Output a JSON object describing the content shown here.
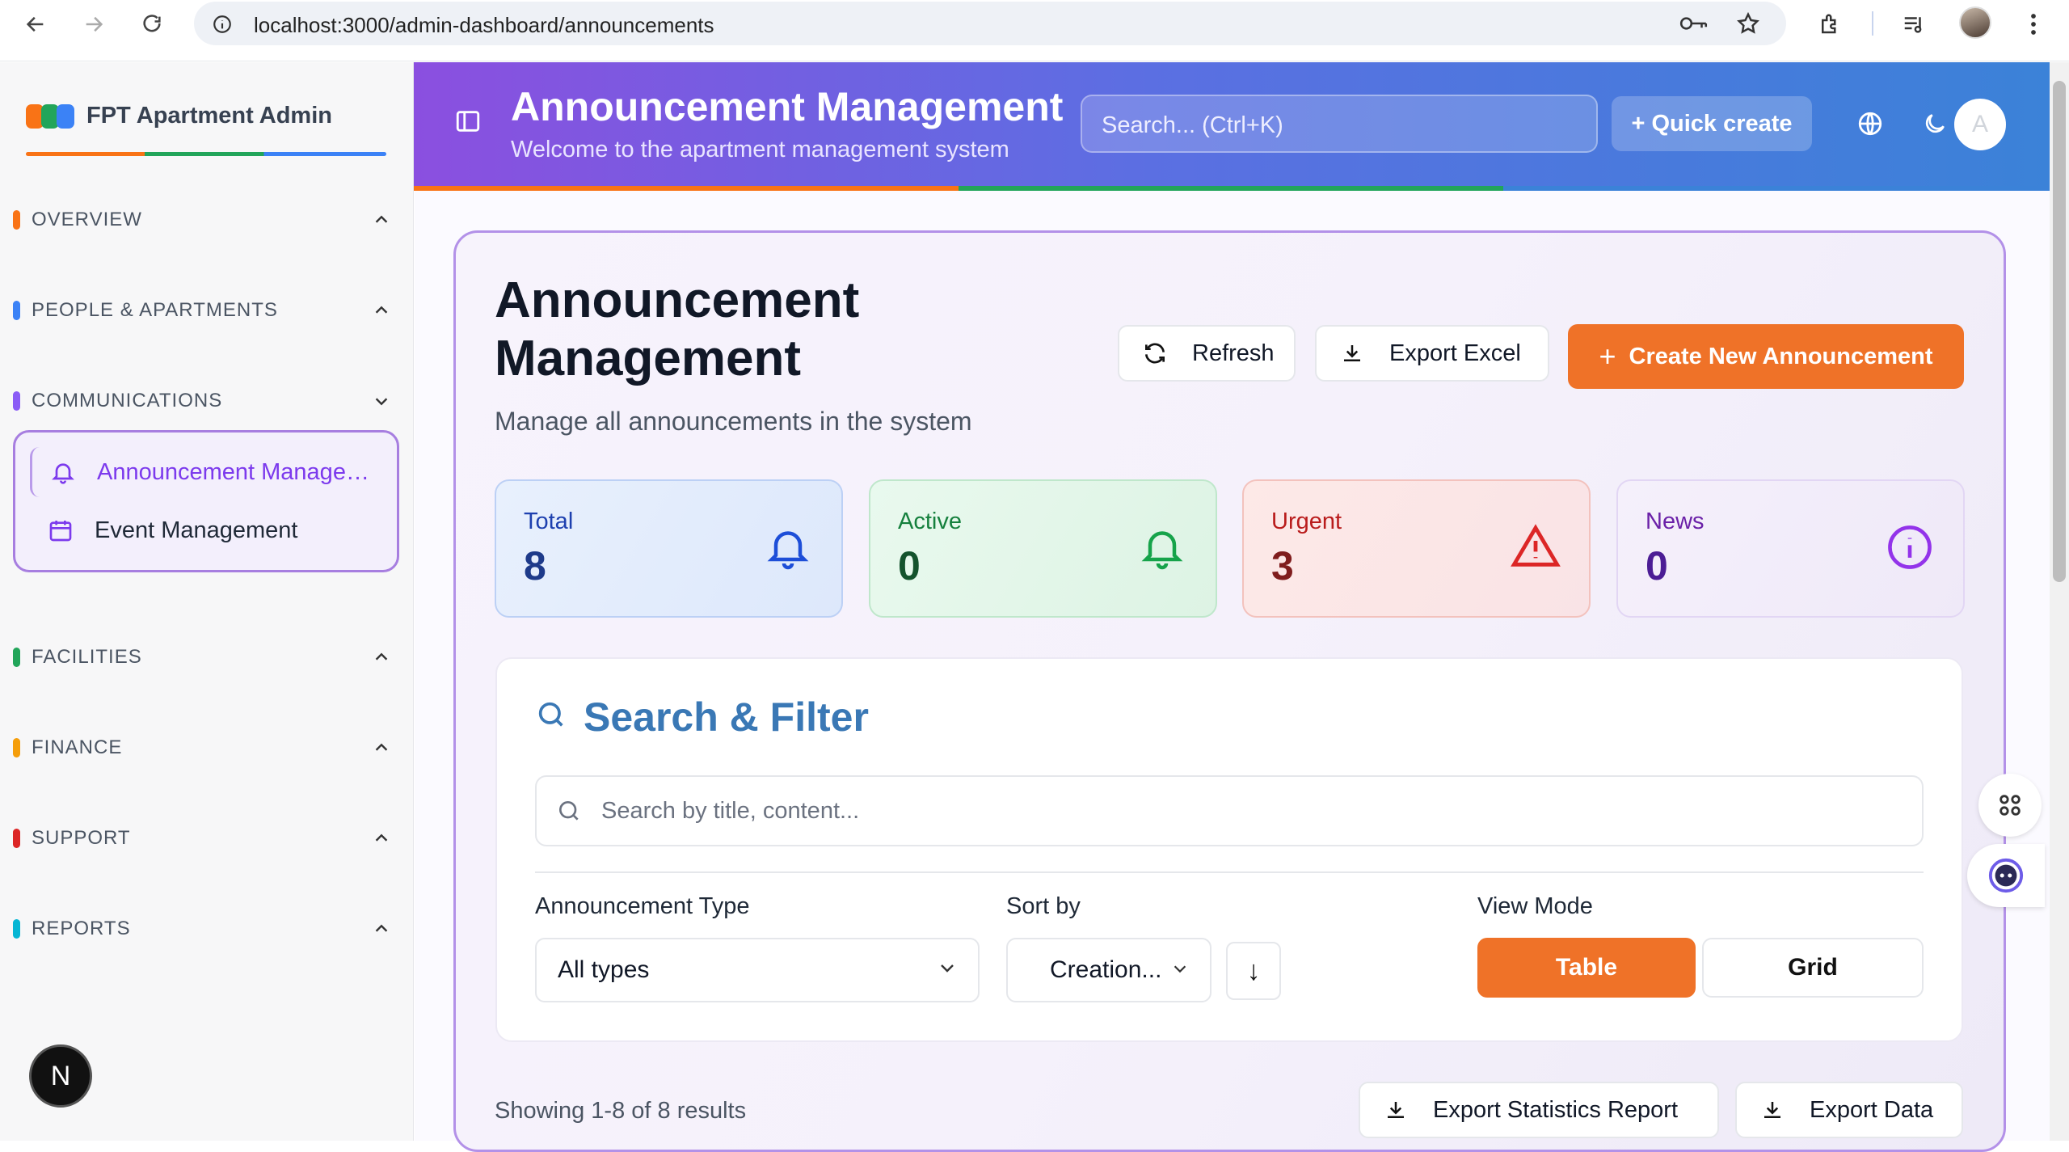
{
  "browser": {
    "url": "localhost:3000/admin-dashboard/announcements"
  },
  "sidebar": {
    "brand": "FPT Apartment Admin",
    "sections": [
      {
        "label": "OVERVIEW",
        "color": "#f97316"
      },
      {
        "label": "PEOPLE & APARTMENTS",
        "color": "#3b82f6"
      },
      {
        "label": "COMMUNICATIONS",
        "color": "#8b5cf6"
      },
      {
        "label": "FACILITIES",
        "color": "#22a55a"
      },
      {
        "label": "FINANCE",
        "color": "#f59e0b"
      },
      {
        "label": "SUPPORT",
        "color": "#dc2626"
      },
      {
        "label": "REPORTS",
        "color": "#06b6d4"
      }
    ],
    "communications_items": [
      {
        "label": "Announcement Management",
        "icon": "bell-icon",
        "active": true
      },
      {
        "label": "Event Management",
        "icon": "calendar-icon",
        "active": false
      }
    ],
    "bottom_badge": "N"
  },
  "header": {
    "title": "Announcement Management",
    "subtitle": "Welcome to the apartment management system",
    "search_placeholder": "Search... (Ctrl+K)",
    "quick_create": "+ Quick create",
    "avatar_letter": "A"
  },
  "page": {
    "title": "Announcement Management",
    "subtitle": "Manage all announcements in the system",
    "refresh": "Refresh",
    "export_excel": "Export Excel",
    "create": "Create New Announcement",
    "stats": [
      {
        "label": "Total",
        "value": "8",
        "icon": "bell-icon"
      },
      {
        "label": "Active",
        "value": "0",
        "icon": "bell-icon"
      },
      {
        "label": "Urgent",
        "value": "3",
        "icon": "warning-icon"
      },
      {
        "label": "News",
        "value": "0",
        "icon": "info-icon"
      }
    ],
    "filter": {
      "title": "Search & Filter",
      "search_placeholder": "Search by title, content...",
      "type_label": "Announcement Type",
      "type_value": "All types",
      "sort_label": "Sort by",
      "sort_value": "Creation...",
      "sort_direction": "↓",
      "view_label": "View Mode",
      "view_table": "Table",
      "view_grid": "Grid"
    },
    "showing": "Showing 1-8 of 8 results",
    "export_stats": "Export Statistics Report",
    "export_data": "Export Data"
  },
  "colors": {
    "accent": "#ef7228",
    "purple": "#7c3aed",
    "header_start": "#8b4fe0",
    "header_end": "#3b82d8"
  }
}
